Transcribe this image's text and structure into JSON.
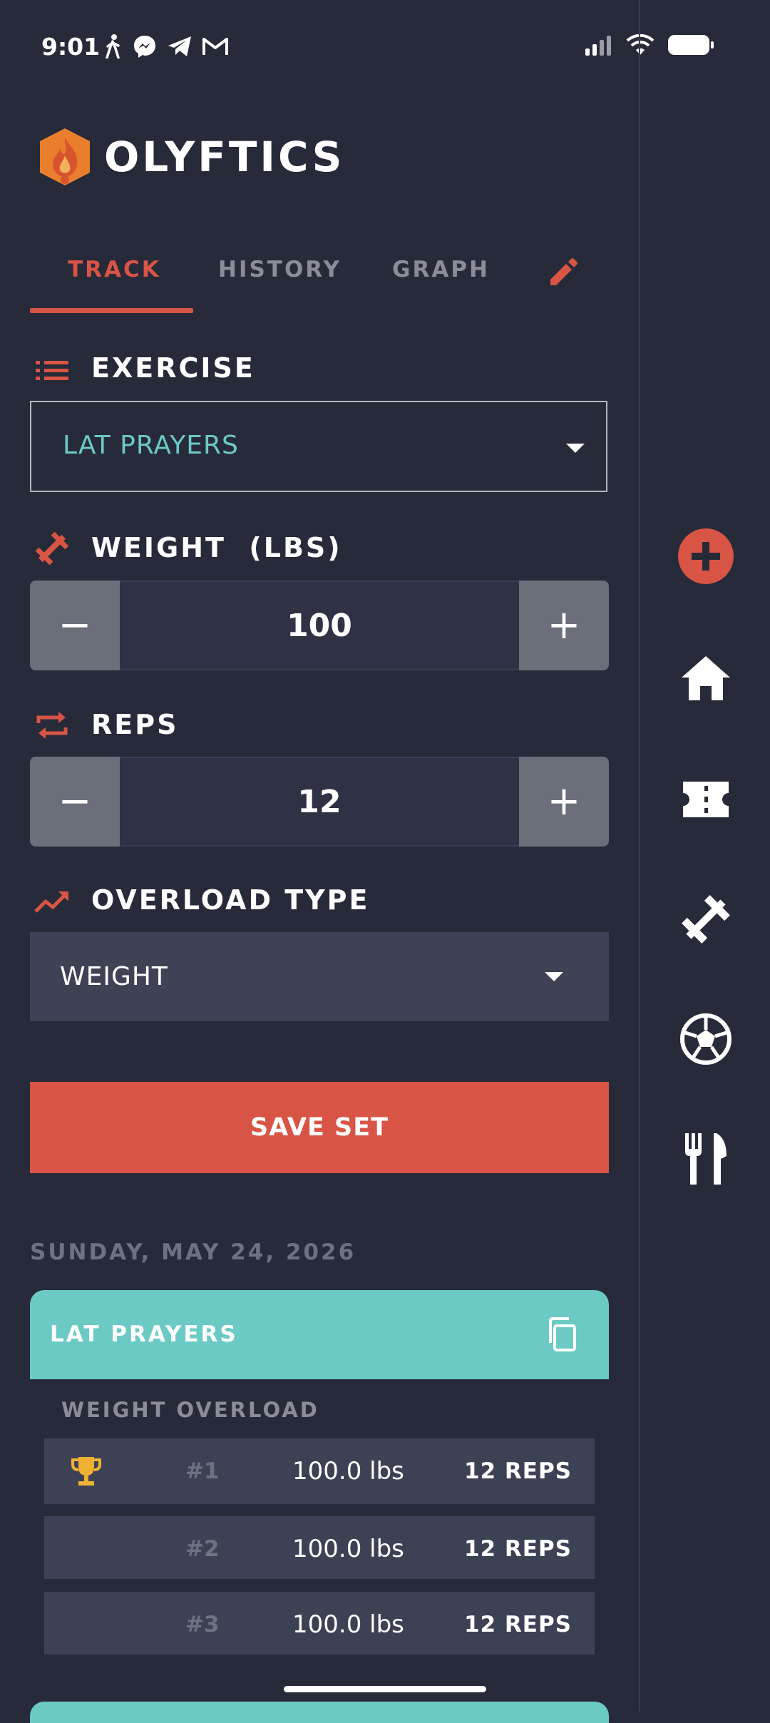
{
  "status_bar": {
    "time": "9:01",
    "left_icons": [
      "walking-icon",
      "messenger-icon",
      "telegram-icon",
      "gmail-icon"
    ],
    "right_icons": [
      "signal-icon",
      "wifi-icon",
      "battery-icon"
    ]
  },
  "app": {
    "name": "OLYFTICS",
    "accent": "#d85545",
    "teal": "#6ccac4"
  },
  "tabs": [
    {
      "label": "TRACK",
      "active": true
    },
    {
      "label": "HISTORY",
      "active": false
    },
    {
      "label": "GRAPH",
      "active": false
    }
  ],
  "exercise": {
    "label": "EXERCISE",
    "selected": "LAT PRAYERS"
  },
  "weight": {
    "label": "WEIGHT  (LBS)",
    "value": "100",
    "minus": "−",
    "plus": "+"
  },
  "reps": {
    "label": "REPS",
    "value": "12",
    "minus": "−",
    "plus": "+"
  },
  "overload": {
    "label": "OVERLOAD TYPE",
    "selected": "WEIGHT"
  },
  "save_button": "SAVE SET",
  "history": {
    "date": "SUNDAY, MAY 24, 2026",
    "card": {
      "title": "LAT PRAYERS",
      "overload_label": "WEIGHT OVERLOAD",
      "sets": [
        {
          "rank": "#1",
          "weight": "100.0 lbs",
          "reps": "12 REPS",
          "best": true
        },
        {
          "rank": "#2",
          "weight": "100.0 lbs",
          "reps": "12 REPS",
          "best": false
        },
        {
          "rank": "#3",
          "weight": "100.0 lbs",
          "reps": "12 REPS",
          "best": false
        }
      ]
    }
  },
  "rail": [
    "add-icon",
    "home-icon",
    "ticket-icon",
    "dumbbell-icon",
    "soccer-ball-icon",
    "utensils-icon"
  ]
}
